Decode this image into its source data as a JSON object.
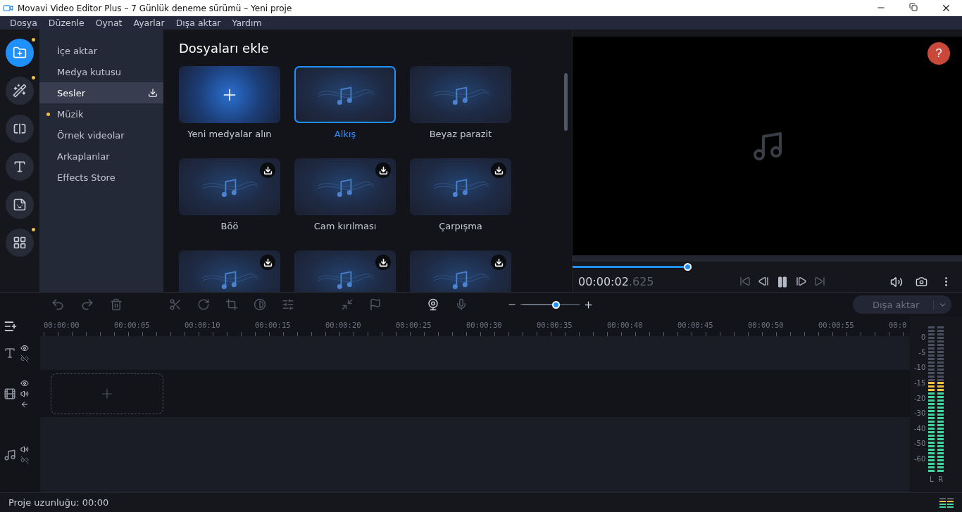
{
  "window": {
    "title": "Movavi Video Editor Plus – 7 Günlük deneme sürümü – Yeni proje"
  },
  "menu": [
    "Dosya",
    "Düzenle",
    "Oynat",
    "Ayarlar",
    "Dışa aktar",
    "Yardım"
  ],
  "rail": [
    {
      "kind": "import",
      "selected": true,
      "dot": true
    },
    {
      "kind": "effects",
      "selected": false,
      "dot": true
    },
    {
      "kind": "transitions",
      "selected": false,
      "dot": false
    },
    {
      "kind": "titles",
      "selected": false,
      "dot": false
    },
    {
      "kind": "stickers",
      "selected": false,
      "dot": false
    },
    {
      "kind": "more",
      "selected": false,
      "dot": true
    }
  ],
  "categories": [
    {
      "label": "İçe aktar",
      "selected": false,
      "dot": false,
      "download": false
    },
    {
      "label": "Medya kutusu",
      "selected": false,
      "dot": false,
      "download": false
    },
    {
      "label": "Sesler",
      "selected": true,
      "dot": false,
      "download": true
    },
    {
      "label": "Müzik",
      "selected": false,
      "dot": true,
      "download": false
    },
    {
      "label": "Örnek videolar",
      "selected": false,
      "dot": false,
      "download": false
    },
    {
      "label": "Arkaplanlar",
      "selected": false,
      "dot": false,
      "download": false
    },
    {
      "label": "Effects Store",
      "selected": false,
      "dot": false,
      "download": false
    }
  ],
  "content": {
    "title": "Dosyaları ekle",
    "tiles": [
      {
        "kind": "add",
        "label": "Yeni medyalar alın",
        "selected": false,
        "download": false
      },
      {
        "kind": "sound",
        "label": "Alkış",
        "selected": true,
        "download": false
      },
      {
        "kind": "sound",
        "label": "Beyaz parazit",
        "selected": false,
        "download": false
      },
      {
        "kind": "sound",
        "label": "Böö",
        "selected": false,
        "download": true
      },
      {
        "kind": "sound",
        "label": "Cam kırılması",
        "selected": false,
        "download": true
      },
      {
        "kind": "sound",
        "label": "Çarpışma",
        "selected": false,
        "download": true
      },
      {
        "kind": "sound",
        "selected": false,
        "download": true
      },
      {
        "kind": "sound",
        "selected": false,
        "download": true
      },
      {
        "kind": "sound",
        "selected": false,
        "download": true
      }
    ]
  },
  "preview": {
    "help": "?",
    "progress": {
      "level": 0.295
    },
    "time": "00:00:02",
    "time_fraction": ".625"
  },
  "timeline": {
    "zoom": {
      "level": 0.6
    },
    "export_button": {
      "label": "Dışa aktar",
      "disabled": true
    },
    "ruler": [
      "00:00:00",
      "00:00:05",
      "00:00:10",
      "00:00:15",
      "00:00:20",
      "00:00:25",
      "00:00:30",
      "00:00:35",
      "00:00:40",
      "00:00:45",
      "00:00:50",
      "00:00:55",
      "00:0"
    ],
    "tracks": [
      {
        "kind": "text"
      },
      {
        "kind": "video"
      },
      {
        "kind": "audio"
      }
    ]
  },
  "meter": {
    "scale": [
      "0",
      "-5",
      "-10",
      "-15",
      "-20",
      "-30",
      "-40",
      "-50",
      "-60"
    ],
    "channels": [
      {
        "label": "L",
        "level": 0.62
      },
      {
        "label": "R",
        "level": 0.62
      }
    ]
  },
  "status_bar": {
    "text": "Proje uzunluğu: 00:00"
  }
}
